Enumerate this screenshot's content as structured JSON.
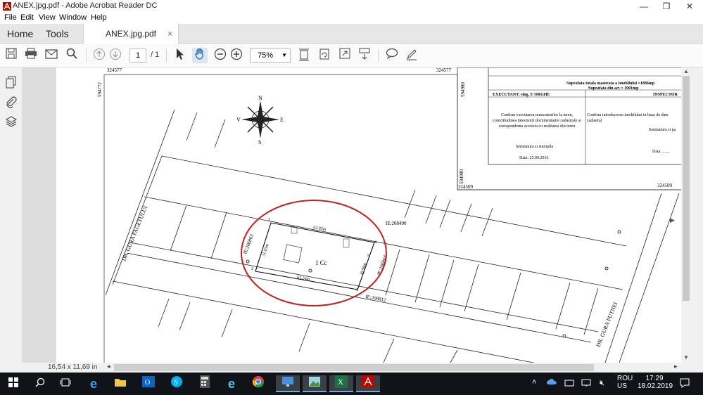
{
  "window": {
    "title": "ANEX.jpg.pdf - Adobe Acrobat Reader DC",
    "minimize": "—",
    "maximize": "❐",
    "close": "✕"
  },
  "menu": [
    "File",
    "Edit",
    "View",
    "Window",
    "Help"
  ],
  "tabs": {
    "home": "Home",
    "tools": "Tools",
    "document": "ANEX.jpg.pdf",
    "document_close": "×"
  },
  "toolbar": {
    "page_current": "1",
    "page_total": "/ 1",
    "zoom": "75%"
  },
  "statusbar": {
    "page_size": "16,54 x 11,69 in"
  },
  "map": {
    "coords": {
      "top_left_x": "324577",
      "top_right_x": "324577",
      "left_y": "594772",
      "right_y_top": "594980",
      "right_y_bottom": "594980",
      "bottom_x_left": "324509",
      "bottom_x_right": "324509"
    },
    "compass": {
      "n": "N",
      "s": "S",
      "e": "E",
      "v": "V"
    },
    "street_left": "DR. GURA FAGETULUI",
    "street_right": "DR. GURA PUTNEI",
    "ie_top": "IE:208490",
    "ie_left": "IE:206863",
    "ie_bottom": "IE:208812",
    "ie_right": "IE:206864",
    "dim_top": "62.05m",
    "dim_bottom": "61.24m",
    "dim_left": "31.05m",
    "dim_right": "30.90m",
    "parcel_label": "1 Cc",
    "vertex_1": "1",
    "vertex_2": "2",
    "vertex_3": "3",
    "vertex_4": "4",
    "vertex_5": "5"
  },
  "info_box": {
    "area_total": "Suprafata totala masurata a imobilului =1886mp",
    "area_act": "Suprafata din act = 1901mp",
    "executant": "EXECUTANT: sing. E          ORGHE",
    "executant_text": "Confirm executarea masuratorilor la teren, corectitudinea intocmirii documentatiei cadastrale si corespondenta acesteia cu realitatea din teren",
    "executant_sign": "Semnatura si stampila",
    "executant_date": "Data: 25.09.2016",
    "inspector": "INSPECTOR",
    "inspector_text": "Confirm introducerea imobilului in baza de date cadastral",
    "inspector_sign": "Semnatura si pa",
    "inspector_date": "Data ........"
  },
  "taskbar": {
    "lang_top": "ROU",
    "lang_bottom": "US",
    "time": "17:29",
    "date": "18.02.2019"
  },
  "colors": {
    "circle": "#c21f1f",
    "accent": "#7aa6d8"
  }
}
